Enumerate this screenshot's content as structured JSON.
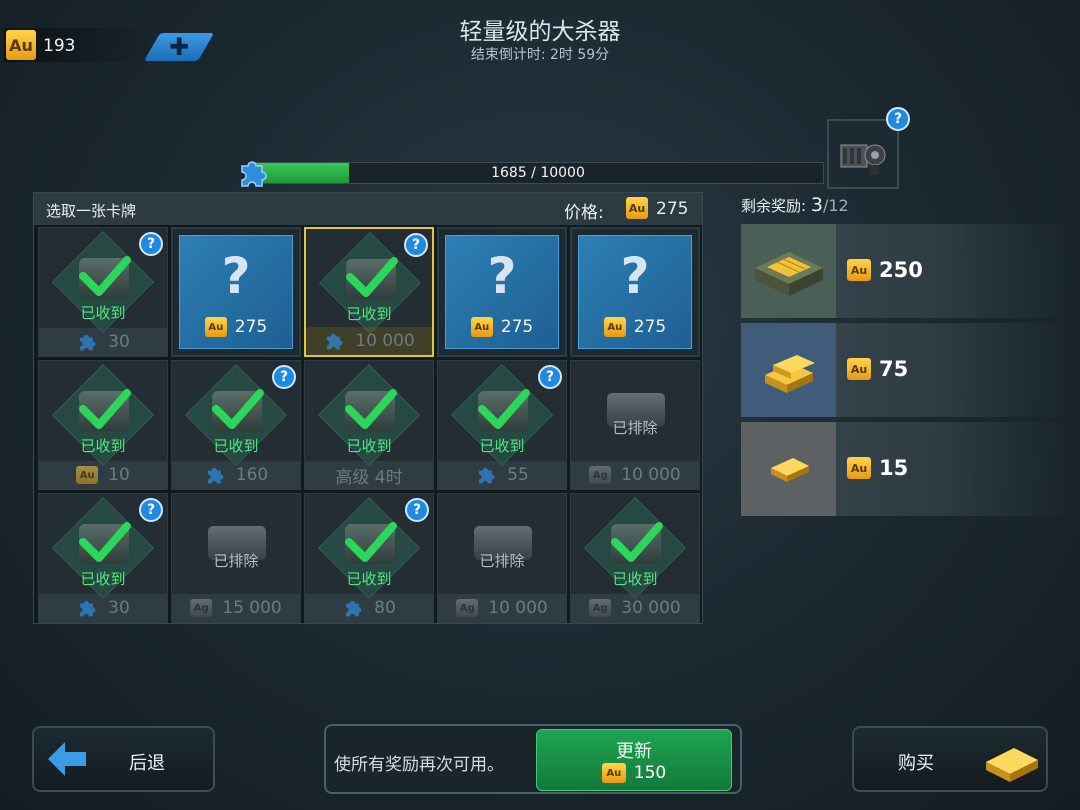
{
  "top": {
    "gold_icon": "Au",
    "gold_amount": "193",
    "add_label": "✚",
    "title": "轻量级的大杀器",
    "countdown": "结束倒计时: 2时 59分"
  },
  "progress": {
    "text": "1685 / 10000",
    "current": 1685,
    "max": 10000
  },
  "panel": {
    "title": "选取一张卡牌",
    "price_label": "价格:",
    "price_value": "275"
  },
  "cards": [
    {
      "type": "collected",
      "status": "已收到",
      "foot_icon": "puzzle",
      "foot": "30",
      "help": "?"
    },
    {
      "type": "hidden",
      "qmark": "?",
      "price": "275"
    },
    {
      "type": "collected",
      "status": "已收到",
      "foot_icon": "puzzle",
      "foot": "10 000",
      "help": "?",
      "selected": true
    },
    {
      "type": "hidden",
      "qmark": "?",
      "price": "275"
    },
    {
      "type": "hidden",
      "qmark": "?",
      "price": "275"
    },
    {
      "type": "collected",
      "status": "已收到",
      "foot_icon": "Au",
      "foot": "10"
    },
    {
      "type": "collected",
      "status": "已收到",
      "foot_icon": "puzzle",
      "foot": "160",
      "help": "?"
    },
    {
      "type": "collected",
      "status": "已收到",
      "foot_icon": "",
      "foot": "高级 4时"
    },
    {
      "type": "collected",
      "status": "已收到",
      "foot_icon": "puzzle",
      "foot": "55",
      "help": "?"
    },
    {
      "type": "excluded",
      "status": "已排除",
      "foot_icon": "Ag",
      "foot": "10 000"
    },
    {
      "type": "collected",
      "status": "已收到",
      "foot_icon": "puzzle",
      "foot": "30",
      "help": "?"
    },
    {
      "type": "excluded",
      "status": "已排除",
      "foot_icon": "Ag",
      "foot": "15 000"
    },
    {
      "type": "collected",
      "status": "已收到",
      "foot_icon": "puzzle",
      "foot": "80",
      "help": "?"
    },
    {
      "type": "excluded",
      "status": "已排除",
      "foot_icon": "Ag",
      "foot": "10 000"
    },
    {
      "type": "collected",
      "status": "已收到",
      "foot_icon": "Ag",
      "foot": "30 000"
    }
  ],
  "rewards": {
    "remaining_label": "剩余奖励:",
    "remaining_count": "3",
    "remaining_total": "/12",
    "help": "?",
    "items": [
      {
        "icon": "gold-crate-icon",
        "value": "250"
      },
      {
        "icon": "gold-bars-icon",
        "value": "75"
      },
      {
        "icon": "gold-bar-icon",
        "value": "15"
      }
    ]
  },
  "bottom": {
    "back_label": "后退",
    "refresh_text": "使所有奖励再次可用。",
    "refresh_label": "更新",
    "refresh_cost": "150",
    "buy_label": "购买"
  },
  "colors": {
    "accent_green": "#1fa452",
    "accent_blue": "#1e8be0",
    "gold": "#f2b52a",
    "selected_border": "#e3c53a"
  }
}
